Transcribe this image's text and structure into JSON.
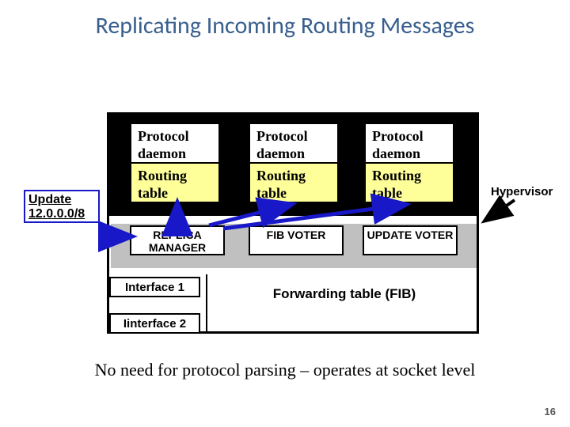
{
  "title": "Replicating Incoming Routing Messages",
  "columns": {
    "pd_label": "Protocol\ndaemon",
    "rt_label": "Routing\ntable"
  },
  "midboxes": {
    "replica": "REPLICA MANAGER",
    "fibvoter": "FIB VOTER",
    "updvoter": "UPDATE VOTER"
  },
  "interfaces": {
    "if1": "Interface 1",
    "if2": "Iinterface 2"
  },
  "fib": "Forwarding table (FIB)",
  "update": {
    "line1": "Update",
    "line2": "12.0.0.0/8"
  },
  "hypervisor": "Hypervisor",
  "subtitle": "No need for protocol parsing – operates at socket level",
  "page": "16"
}
